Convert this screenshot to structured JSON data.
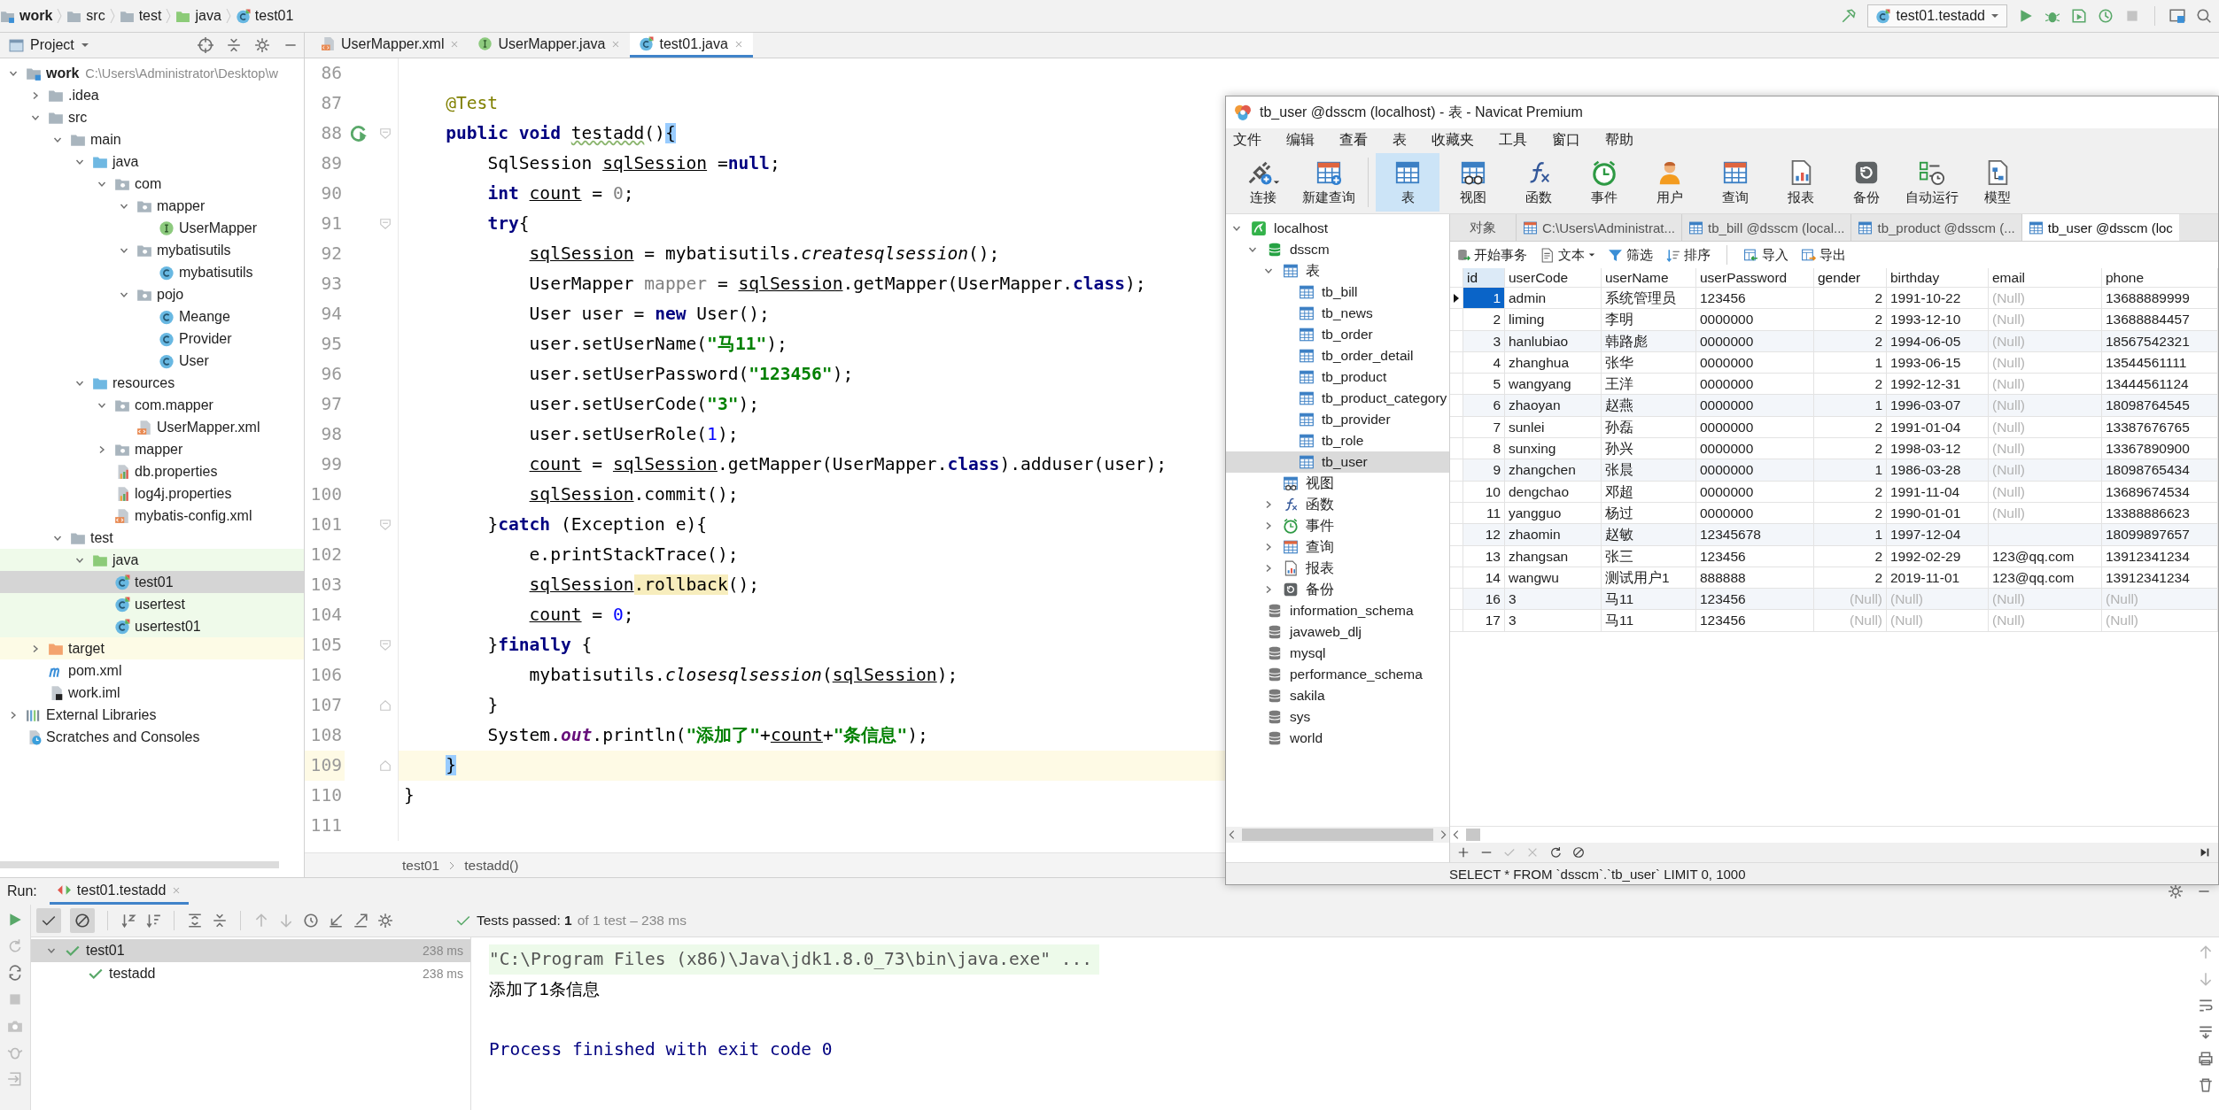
{
  "ide": {
    "breadcrumb": [
      {
        "label": "work",
        "kind": "module"
      },
      {
        "label": "src",
        "kind": "folder"
      },
      {
        "label": "test",
        "kind": "folder"
      },
      {
        "label": "java",
        "kind": "test-folder"
      },
      {
        "label": "test01",
        "kind": "test-class"
      }
    ],
    "run_configuration": "test01.testadd",
    "project": {
      "title": "Project",
      "tree": [
        {
          "name": "work",
          "path": "C:\\Users\\Administrator\\Desktop\\w",
          "kind": "module",
          "selected": false,
          "expanded": true,
          "children": [
            {
              "name": ".idea",
              "kind": "folder",
              "selected": false,
              "expanded": false
            },
            {
              "name": "src",
              "kind": "folder",
              "selected": false,
              "expanded": true,
              "children": [
                {
                  "name": "main",
                  "kind": "folder",
                  "selected": false,
                  "expanded": true,
                  "children": [
                    {
                      "name": "java",
                      "kind": "source-folder",
                      "selected": false,
                      "expanded": true,
                      "children": [
                        {
                          "name": "com",
                          "kind": "package",
                          "selected": false,
                          "expanded": true,
                          "children": [
                            {
                              "name": "mapper",
                              "kind": "package",
                              "selected": false,
                              "expanded": true,
                              "children": [
                                {
                                  "name": "UserMapper",
                                  "kind": "interface",
                                  "selected": false
                                }
                              ]
                            },
                            {
                              "name": "mybatisutils",
                              "kind": "package",
                              "selected": false,
                              "expanded": true,
                              "children": [
                                {
                                  "name": "mybatisutils",
                                  "kind": "class",
                                  "selected": false
                                }
                              ]
                            },
                            {
                              "name": "pojo",
                              "kind": "package",
                              "selected": false,
                              "expanded": true,
                              "children": [
                                {
                                  "name": "Meange",
                                  "kind": "class",
                                  "selected": false
                                },
                                {
                                  "name": "Provider",
                                  "kind": "class",
                                  "selected": false
                                },
                                {
                                  "name": "User",
                                  "kind": "class",
                                  "selected": false
                                }
                              ]
                            }
                          ]
                        }
                      ]
                    },
                    {
                      "name": "resources",
                      "kind": "source-folder",
                      "selected": false,
                      "expanded": true,
                      "children": [
                        {
                          "name": "com.mapper",
                          "kind": "package",
                          "selected": false,
                          "expanded": true,
                          "children": [
                            {
                              "name": "UserMapper.xml",
                              "kind": "xml",
                              "selected": false
                            }
                          ]
                        },
                        {
                          "name": "mapper",
                          "kind": "package",
                          "selected": false,
                          "expanded": false
                        },
                        {
                          "name": "db.properties",
                          "kind": "properties",
                          "selected": false
                        },
                        {
                          "name": "log4j.properties",
                          "kind": "properties",
                          "selected": false
                        },
                        {
                          "name": "mybatis-config.xml",
                          "kind": "xml",
                          "selected": false
                        }
                      ]
                    }
                  ]
                },
                {
                  "name": "test",
                  "kind": "folder",
                  "selected": false,
                  "expanded": true,
                  "children": [
                    {
                      "name": "java",
                      "kind": "test-folder",
                      "selected": false,
                      "expanded": true,
                      "children": [
                        {
                          "name": "test01",
                          "kind": "test-class",
                          "selected": true
                        },
                        {
                          "name": "usertest",
                          "kind": "test-class",
                          "selected": false
                        },
                        {
                          "name": "usertest01",
                          "kind": "test-class",
                          "selected": false
                        }
                      ]
                    }
                  ]
                }
              ]
            },
            {
              "name": "target",
              "kind": "excluded-folder",
              "selected": false,
              "expanded": false
            },
            {
              "name": "pom.xml",
              "kind": "maven",
              "selected": false
            },
            {
              "name": "work.iml",
              "kind": "iml",
              "selected": false
            }
          ]
        },
        {
          "name": "External Libraries",
          "kind": "libraries",
          "selected": false,
          "expanded": false
        },
        {
          "name": "Scratches and Consoles",
          "kind": "scratches",
          "selected": false
        }
      ]
    },
    "editor": {
      "tabs": [
        {
          "label": "UserMapper.xml",
          "kind": "xml",
          "selected": false
        },
        {
          "label": "UserMapper.java",
          "kind": "interface",
          "selected": false
        },
        {
          "label": "test01.java",
          "kind": "test-class",
          "selected": true
        }
      ],
      "lines": [
        {
          "number": "86",
          "current": false
        },
        {
          "number": "87",
          "current": false,
          "tokens": [
            {
              "text": "    @Test",
              "kind": "annotation"
            }
          ]
        },
        {
          "number": "88",
          "current": false,
          "markers": [
            {
              "kind": "run"
            },
            {
              "kind": "fold-start"
            }
          ],
          "tokens": [
            {
              "text": "    public void",
              "kind": "keyword"
            },
            {
              "text": " testadd",
              "kind": "typo"
            },
            {
              "text": "()",
              "kind": "plain"
            },
            {
              "text": "{",
              "kind": "match"
            }
          ]
        },
        {
          "number": "89",
          "current": false,
          "tokens": [
            {
              "text": "        SqlSession ",
              "kind": "plain"
            },
            {
              "text": "sqlSession",
              "kind": "var"
            },
            {
              "text": " =",
              "kind": "plain"
            },
            {
              "text": "null",
              "kind": "keyword"
            },
            {
              "text": ";",
              "kind": "plain"
            }
          ]
        },
        {
          "number": "90",
          "current": false,
          "tokens": [
            {
              "text": "        int",
              "kind": "keyword"
            },
            {
              "text": " count",
              "kind": "var"
            },
            {
              "text": " = ",
              "kind": "plain"
            },
            {
              "text": "0",
              "kind": "unused"
            },
            {
              "text": ";",
              "kind": "plain"
            }
          ]
        },
        {
          "number": "91",
          "current": false,
          "markers": [
            {
              "kind": "fold-start"
            }
          ],
          "tokens": [
            {
              "text": "        try",
              "kind": "keyword"
            },
            {
              "text": "{",
              "kind": "plain"
            }
          ]
        },
        {
          "number": "92",
          "current": false,
          "tokens": [
            {
              "text": "            sqlSession",
              "kind": "var"
            },
            {
              "text": " = mybatisutils.",
              "kind": "plain"
            },
            {
              "text": "createsqlsession",
              "kind": "static"
            },
            {
              "text": "();",
              "kind": "plain"
            }
          ]
        },
        {
          "number": "93",
          "current": false,
          "tokens": [
            {
              "text": "            UserMapper ",
              "kind": "plain"
            },
            {
              "text": "mapper",
              "kind": "unused"
            },
            {
              "text": " = ",
              "kind": "plain"
            },
            {
              "text": "sqlSession",
              "kind": "var"
            },
            {
              "text": ".getMapper(UserMapper.",
              "kind": "plain"
            },
            {
              "text": "class",
              "kind": "keyword"
            },
            {
              "text": ");",
              "kind": "plain"
            }
          ]
        },
        {
          "number": "94",
          "current": false,
          "tokens": [
            {
              "text": "            User user = ",
              "kind": "plain"
            },
            {
              "text": "new",
              "kind": "keyword"
            },
            {
              "text": " User();",
              "kind": "plain"
            }
          ]
        },
        {
          "number": "95",
          "current": false,
          "tokens": [
            {
              "text": "            user.setUserName(",
              "kind": "plain"
            },
            {
              "text": "\"马11\"",
              "kind": "string"
            },
            {
              "text": ");",
              "kind": "plain"
            }
          ]
        },
        {
          "number": "96",
          "current": false,
          "tokens": [
            {
              "text": "            user.setUserPassword(",
              "kind": "plain"
            },
            {
              "text": "\"123456\"",
              "kind": "string"
            },
            {
              "text": ");",
              "kind": "plain"
            }
          ]
        },
        {
          "number": "97",
          "current": false,
          "tokens": [
            {
              "text": "            user.setUserCode(",
              "kind": "plain"
            },
            {
              "text": "\"3\"",
              "kind": "string"
            },
            {
              "text": ");",
              "kind": "plain"
            }
          ]
        },
        {
          "number": "98",
          "current": false,
          "tokens": [
            {
              "text": "            user.setUserRole(",
              "kind": "plain"
            },
            {
              "text": "1",
              "kind": "number"
            },
            {
              "text": ");",
              "kind": "plain"
            }
          ]
        },
        {
          "number": "99",
          "current": false,
          "tokens": [
            {
              "text": "            count",
              "kind": "var"
            },
            {
              "text": " = ",
              "kind": "plain"
            },
            {
              "text": "sqlSession",
              "kind": "var"
            },
            {
              "text": ".getMapper(UserMapper.",
              "kind": "plain"
            },
            {
              "text": "class",
              "kind": "keyword"
            },
            {
              "text": ").adduser(user);",
              "kind": "plain"
            }
          ]
        },
        {
          "number": "100",
          "current": false,
          "tokens": [
            {
              "text": "            sqlSession",
              "kind": "var"
            },
            {
              "text": ".commit();",
              "kind": "plain"
            }
          ]
        },
        {
          "number": "101",
          "current": false,
          "markers": [
            {
              "kind": "fold-start"
            }
          ],
          "tokens": [
            {
              "text": "        }",
              "kind": "plain"
            },
            {
              "text": "catch",
              "kind": "keyword"
            },
            {
              "text": " (Exception e){",
              "kind": "plain"
            }
          ]
        },
        {
          "number": "102",
          "current": false,
          "tokens": [
            {
              "text": "            e.printStackTrace();",
              "kind": "plain"
            }
          ]
        },
        {
          "number": "103",
          "current": false,
          "tokens": [
            {
              "text": "            sqlSession",
              "kind": "var"
            },
            {
              "text": ".rollback",
              "kind": "highlight"
            },
            {
              "text": "();",
              "kind": "plain"
            }
          ]
        },
        {
          "number": "104",
          "current": false,
          "tokens": [
            {
              "text": "            count",
              "kind": "var"
            },
            {
              "text": " = ",
              "kind": "plain"
            },
            {
              "text": "0",
              "kind": "number"
            },
            {
              "text": ";",
              "kind": "plain"
            }
          ]
        },
        {
          "number": "105",
          "current": false,
          "markers": [
            {
              "kind": "fold-start"
            }
          ],
          "tokens": [
            {
              "text": "        }",
              "kind": "plain"
            },
            {
              "text": "finally",
              "kind": "keyword"
            },
            {
              "text": " {",
              "kind": "plain"
            }
          ]
        },
        {
          "number": "106",
          "current": false,
          "tokens": [
            {
              "text": "            mybatisutils.",
              "kind": "plain"
            },
            {
              "text": "closesqlsession",
              "kind": "static"
            },
            {
              "text": "(",
              "kind": "plain"
            },
            {
              "text": "sqlSession",
              "kind": "var"
            },
            {
              "text": ");",
              "kind": "plain"
            }
          ]
        },
        {
          "number": "107",
          "current": false,
          "markers": [
            {
              "kind": "fold-end"
            }
          ],
          "tokens": [
            {
              "text": "        }",
              "kind": "plain"
            }
          ]
        },
        {
          "number": "108",
          "current": false,
          "tokens": [
            {
              "text": "        System.",
              "kind": "plain"
            },
            {
              "text": "out",
              "kind": "static-field"
            },
            {
              "text": ".println(",
              "kind": "plain"
            },
            {
              "text": "\"添加了\"",
              "kind": "string"
            },
            {
              "text": "+",
              "kind": "plain"
            },
            {
              "text": "count",
              "kind": "var"
            },
            {
              "text": "+",
              "kind": "plain"
            },
            {
              "text": "\"条信息\"",
              "kind": "string"
            },
            {
              "text": ");",
              "kind": "plain"
            }
          ]
        },
        {
          "number": "109",
          "current": true,
          "markers": [
            {
              "kind": "fold-end"
            }
          ],
          "tokens": [
            {
              "text": "    }",
              "kind": "match"
            }
          ]
        },
        {
          "number": "110",
          "current": false,
          "tokens": [
            {
              "text": "}",
              "kind": "plain"
            }
          ]
        },
        {
          "number": "111",
          "current": false
        }
      ],
      "breadcrumb": [
        "test01",
        "testadd()"
      ]
    },
    "run": {
      "title": "Run:",
      "tab": "test01.testadd",
      "filters": [
        {
          "kind": "passed",
          "on": true
        },
        {
          "kind": "ignored",
          "on": true
        }
      ],
      "status": "Tests passed: **1**",
      "status_detail": "of 1 test – 238 ms",
      "tests": [
        {
          "name": "test01",
          "duration": "238 ms",
          "passed": true,
          "selected": true,
          "expanded": true,
          "children": [
            {
              "name": "testadd",
              "duration": "238 ms",
              "passed": true,
              "selected": false
            }
          ]
        }
      ],
      "console": [
        {
          "kind": "command",
          "text": "\"C:\\Program Files (x86)\\Java\\jdk1.8.0_73\\bin\\java.exe\" ..."
        },
        {
          "kind": "output",
          "text": "添加了1条信息"
        },
        {
          "kind": "system",
          "text": "Process finished with exit code 0"
        }
      ]
    }
  },
  "navicat": {
    "title": "tb_user @dsscm (localhost) - 表 - Navicat Premium",
    "menu": [
      "文件",
      "编辑",
      "查看",
      "表",
      "收藏夹",
      "工具",
      "窗口",
      "帮助"
    ],
    "toolbar": [
      {
        "label": "连接",
        "kind": "connect",
        "selected": false,
        "dropdown": true
      },
      {
        "label": "新建查询",
        "kind": "new-query",
        "selected": false,
        "dropdown": false
      },
      {
        "label": "表",
        "kind": "table",
        "selected": true,
        "dropdown": false
      },
      {
        "label": "视图",
        "kind": "view",
        "selected": false,
        "dropdown": false
      },
      {
        "label": "函数",
        "kind": "function",
        "selected": false,
        "dropdown": false
      },
      {
        "label": "事件",
        "kind": "event",
        "selected": false,
        "dropdown": false
      },
      {
        "label": "用户",
        "kind": "user",
        "selected": false,
        "dropdown": false
      },
      {
        "label": "查询",
        "kind": "query",
        "selected": false,
        "dropdown": false
      },
      {
        "label": "报表",
        "kind": "report",
        "selected": false,
        "dropdown": false
      },
      {
        "label": "备份",
        "kind": "backup",
        "selected": false,
        "dropdown": false
      },
      {
        "label": "自动运行",
        "kind": "automation",
        "selected": false,
        "dropdown": false
      },
      {
        "label": "模型",
        "kind": "model",
        "selected": false,
        "dropdown": false
      }
    ],
    "tree": [
      {
        "name": "localhost",
        "kind": "connection",
        "selected": false,
        "expanded": true,
        "children": [
          {
            "name": "dsscm",
            "kind": "database-open",
            "selected": false,
            "expanded": true,
            "children": [
              {
                "name": "表",
                "kind": "table",
                "selected": false,
                "expanded": true,
                "children": [
                  {
                    "name": "tb_bill",
                    "kind": "table",
                    "selected": false
                  },
                  {
                    "name": "tb_news",
                    "kind": "table",
                    "selected": false
                  },
                  {
                    "name": "tb_order",
                    "kind": "table",
                    "selected": false
                  },
                  {
                    "name": "tb_order_detail",
                    "kind": "table",
                    "selected": false
                  },
                  {
                    "name": "tb_product",
                    "kind": "table",
                    "selected": false
                  },
                  {
                    "name": "tb_product_category",
                    "kind": "table",
                    "selected": false
                  },
                  {
                    "name": "tb_provider",
                    "kind": "table",
                    "selected": false
                  },
                  {
                    "name": "tb_role",
                    "kind": "table",
                    "selected": false
                  },
                  {
                    "name": "tb_user",
                    "kind": "table",
                    "selected": true
                  }
                ]
              },
              {
                "name": "视图",
                "kind": "view",
                "selected": false
              },
              {
                "name": "函数",
                "kind": "function",
                "selected": false,
                "expanded": false
              },
              {
                "name": "事件",
                "kind": "event",
                "selected": false,
                "expanded": false
              },
              {
                "name": "查询",
                "kind": "query",
                "selected": false,
                "expanded": false
              },
              {
                "name": "报表",
                "kind": "report",
                "selected": false,
                "expanded": false
              },
              {
                "name": "备份",
                "kind": "backup",
                "selected": false,
                "expanded": false
              }
            ]
          },
          {
            "name": "information_schema",
            "kind": "database",
            "selected": false
          },
          {
            "name": "javaweb_dlj",
            "kind": "database",
            "selected": false
          },
          {
            "name": "mysql",
            "kind": "database",
            "selected": false
          },
          {
            "name": "performance_schema",
            "kind": "database",
            "selected": false
          },
          {
            "name": "sakila",
            "kind": "database",
            "selected": false
          },
          {
            "name": "sys",
            "kind": "database",
            "selected": false
          },
          {
            "name": "world",
            "kind": "database",
            "selected": false
          }
        ]
      }
    ],
    "tabs": [
      {
        "label": "对象",
        "kind": "objects",
        "selected": false
      },
      {
        "label": "C:\\Users\\Administrat...",
        "kind": "query",
        "selected": false
      },
      {
        "label": "tb_bill @dsscm (local...",
        "kind": "table",
        "selected": false
      },
      {
        "label": "tb_product @dsscm (...",
        "kind": "table",
        "selected": false
      },
      {
        "label": "tb_user @dsscm (loc",
        "kind": "table",
        "selected": true
      }
    ],
    "actions": [
      {
        "label": "开始事务",
        "kind": "transaction",
        "dropdown": false
      },
      {
        "label": "文本",
        "kind": "text",
        "dropdown": true
      },
      {
        "label": "筛选",
        "kind": "filter",
        "dropdown": false
      },
      {
        "label": "排序",
        "kind": "sort",
        "dropdown": false
      },
      {
        "label": "导入",
        "kind": "import",
        "dropdown": false
      },
      {
        "label": "导出",
        "kind": "export",
        "dropdown": false
      }
    ],
    "table": {
      "columns": [
        {
          "label": "id",
          "numeric": true
        },
        {
          "label": "userCode",
          "numeric": false
        },
        {
          "label": "userName",
          "numeric": false
        },
        {
          "label": "userPassword",
          "numeric": false
        },
        {
          "label": "gender",
          "numeric": true
        },
        {
          "label": "birthday",
          "numeric": false
        },
        {
          "label": "email",
          "numeric": false
        },
        {
          "label": "phone",
          "numeric": false
        }
      ],
      "rows": [
        {
          "selected": true,
          "cells": [
            "1",
            "admin",
            "系统管理员",
            "123456",
            "2",
            "1991-10-22",
            {
              "text": "(Null)",
              "kind": "null"
            },
            "13688889999"
          ]
        },
        {
          "selected": false,
          "cells": [
            "2",
            "liming",
            "李明",
            "0000000",
            "2",
            "1993-12-10",
            {
              "text": "(Null)",
              "kind": "null"
            },
            "13688884457"
          ]
        },
        {
          "selected": false,
          "cells": [
            "3",
            "hanlubiao",
            "韩路彪",
            "0000000",
            "2",
            "1994-06-05",
            {
              "text": "(Null)",
              "kind": "null"
            },
            "18567542321"
          ]
        },
        {
          "selected": false,
          "cells": [
            "4",
            "zhanghua",
            "张华",
            "0000000",
            "1",
            "1993-06-15",
            {
              "text": "(Null)",
              "kind": "null"
            },
            "13544561111"
          ]
        },
        {
          "selected": false,
          "cells": [
            "5",
            "wangyang",
            "王洋",
            "0000000",
            "2",
            "1992-12-31",
            {
              "text": "(Null)",
              "kind": "null"
            },
            "13444561124"
          ]
        },
        {
          "selected": false,
          "cells": [
            "6",
            "zhaoyan",
            "赵燕",
            "0000000",
            "1",
            "1996-03-07",
            {
              "text": "(Null)",
              "kind": "null"
            },
            "18098764545"
          ]
        },
        {
          "selected": false,
          "cells": [
            "7",
            "sunlei",
            "孙磊",
            "0000000",
            "2",
            "1991-01-04",
            {
              "text": "(Null)",
              "kind": "null"
            },
            "13387676765"
          ]
        },
        {
          "selected": false,
          "cells": [
            "8",
            "sunxing",
            "孙兴",
            "0000000",
            "2",
            "1998-03-12",
            {
              "text": "(Null)",
              "kind": "null"
            },
            "13367890900"
          ]
        },
        {
          "selected": false,
          "cells": [
            "9",
            "zhangchen",
            "张晨",
            "0000000",
            "1",
            "1986-03-28",
            {
              "text": "(Null)",
              "kind": "null"
            },
            "18098765434"
          ]
        },
        {
          "selected": false,
          "cells": [
            "10",
            "dengchao",
            "邓超",
            "0000000",
            "2",
            "1991-11-04",
            {
              "text": "(Null)",
              "kind": "null"
            },
            "13689674534"
          ]
        },
        {
          "selected": false,
          "cells": [
            "11",
            "yangguo",
            "杨过",
            "0000000",
            "2",
            "1990-01-01",
            {
              "text": "(Null)",
              "kind": "null"
            },
            "13388886623"
          ]
        },
        {
          "selected": false,
          "cells": [
            "12",
            "zhaomin",
            "赵敏",
            "12345678",
            "1",
            "1997-12-04",
            null,
            "18099897657"
          ]
        },
        {
          "selected": false,
          "cells": [
            "13",
            "zhangsan",
            "张三",
            "123456",
            "2",
            "1992-02-29",
            "123@qq.com",
            "13912341234"
          ]
        },
        {
          "selected": false,
          "cells": [
            "14",
            "wangwu",
            "测试用户1",
            "888888",
            "2",
            "2019-11-01",
            "123@qq.com",
            "13912341234"
          ]
        },
        {
          "selected": false,
          "cells": [
            "16",
            "3",
            "马11",
            "123456",
            {
              "text": "(Null)",
              "kind": "null"
            },
            {
              "text": "(Null)",
              "kind": "null"
            },
            {
              "text": "(Null)",
              "kind": "null"
            },
            {
              "text": "(Null)",
              "kind": "null"
            }
          ]
        },
        {
          "selected": false,
          "cells": [
            "17",
            "3",
            "马11",
            "123456",
            {
              "text": "(Null)",
              "kind": "null"
            },
            {
              "text": "(Null)",
              "kind": "null"
            },
            {
              "text": "(Null)",
              "kind": "null"
            },
            {
              "text": "(Null)",
              "kind": "null"
            }
          ]
        }
      ]
    },
    "status": "SELECT * FROM `dsscm`.`tb_user` LIMIT 0, 1000"
  }
}
